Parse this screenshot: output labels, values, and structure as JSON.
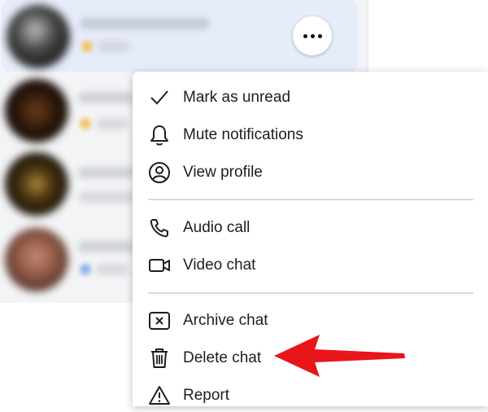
{
  "menu": {
    "items": [
      {
        "label": "Mark as unread",
        "icon": "checkmark-icon"
      },
      {
        "label": "Mute notifications",
        "icon": "bell-icon"
      },
      {
        "label": "View profile",
        "icon": "user-circle-icon"
      },
      {
        "label": "Audio call",
        "icon": "phone-icon"
      },
      {
        "label": "Video chat",
        "icon": "video-camera-icon"
      },
      {
        "label": "Archive chat",
        "icon": "archive-x-icon"
      },
      {
        "label": "Delete chat",
        "icon": "trash-icon"
      },
      {
        "label": "Report",
        "icon": "warning-triangle-icon"
      }
    ]
  },
  "more_button": {
    "icon": "more-horizontal-icon"
  },
  "annotation": {
    "color": "#e8151b",
    "icon": "red-arrow-pointer"
  },
  "colors": {
    "selected_chat_bg": "#e6ecfa",
    "chat_list_bg": "#f3f4f6"
  }
}
